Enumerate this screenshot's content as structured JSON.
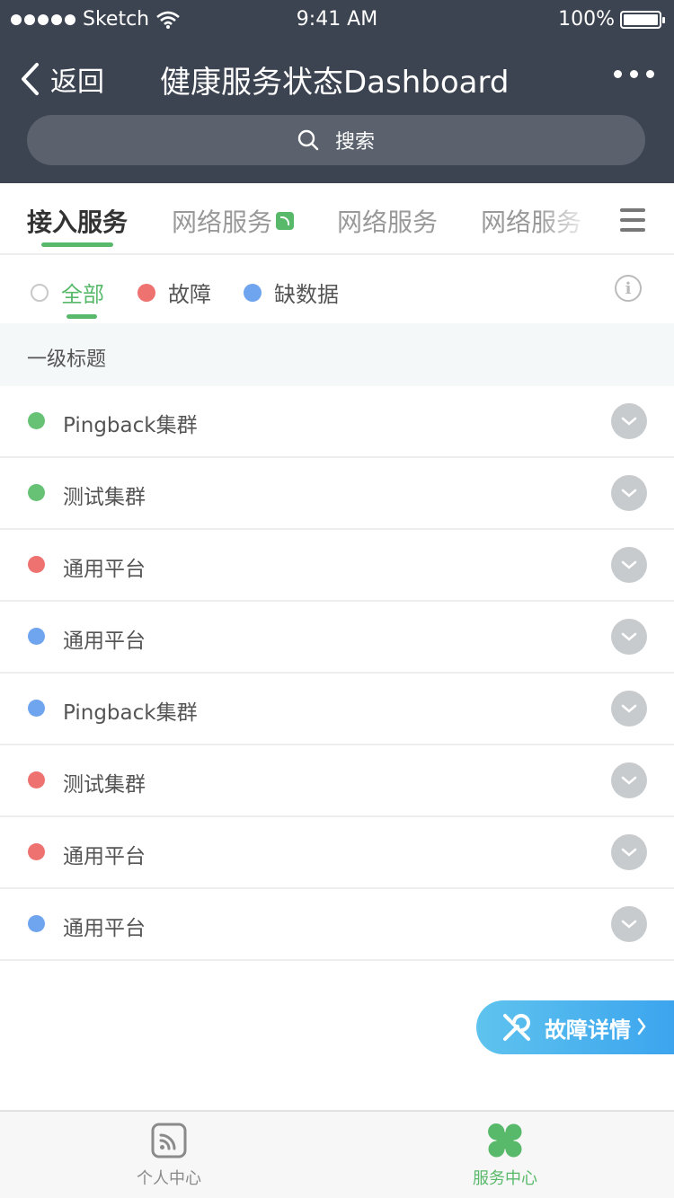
{
  "status_bar": {
    "carrier": "Sketch",
    "time": "9:41 AM",
    "battery": "100%"
  },
  "nav": {
    "back_label": "返回",
    "title": "健康服务状态Dashboard"
  },
  "search": {
    "placeholder": "搜索"
  },
  "tabs": [
    {
      "label": "接入服务",
      "active": true
    },
    {
      "label": "网络服务",
      "badge": true
    },
    {
      "label": "网络服务"
    },
    {
      "label": "网络服务"
    }
  ],
  "filters": [
    {
      "label": "全部",
      "color": "#ffffff",
      "active": true
    },
    {
      "label": "故障",
      "color": "#ee7370"
    },
    {
      "label": "缺数据",
      "color": "#6fa4ef"
    }
  ],
  "section": {
    "title": "一级标题"
  },
  "items": [
    {
      "label": "Pingback集群",
      "status": "normal"
    },
    {
      "label": "测试集群",
      "status": "normal"
    },
    {
      "label": "通用平台",
      "status": "fault"
    },
    {
      "label": "通用平台",
      "status": "missing"
    },
    {
      "label": "Pingback集群",
      "status": "missing"
    },
    {
      "label": "测试集群",
      "status": "fault"
    },
    {
      "label": "通用平台",
      "status": "fault"
    },
    {
      "label": "通用平台",
      "status": "missing"
    }
  ],
  "status_colors": {
    "normal": "#67c276",
    "fault": "#ee7370",
    "missing": "#6fa4ef"
  },
  "fab": {
    "label": "故障详情"
  },
  "tabbar": [
    {
      "label": "个人中心",
      "icon": "rss-icon",
      "active": false
    },
    {
      "label": "服务中心",
      "icon": "clover-icon",
      "active": true
    }
  ],
  "colors": {
    "accent": "#59b96b",
    "header_bg": "#3d4451",
    "fab_blue": "#3aa3ee"
  }
}
